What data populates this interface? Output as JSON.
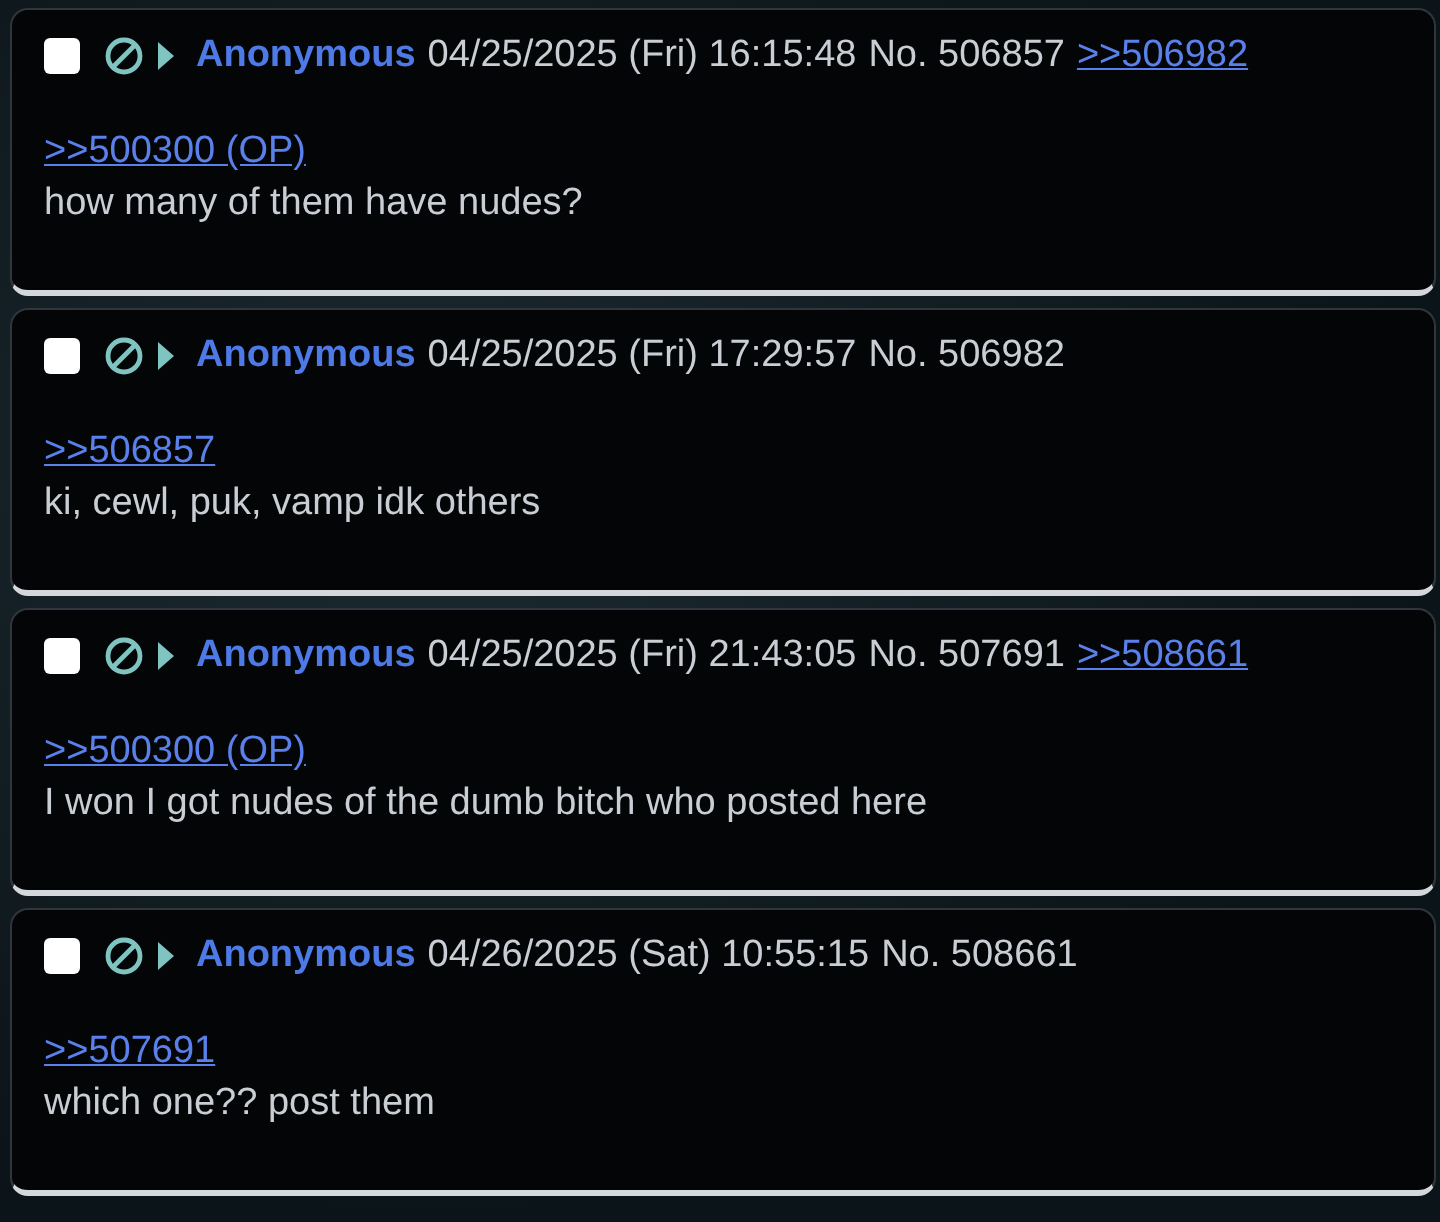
{
  "posts": [
    {
      "checked": false,
      "name": "Anonymous",
      "datetime": "04/25/2025 (Fri) 16:15:48",
      "number": "No. 506857",
      "replies": [
        ">>506982"
      ],
      "quote": ">>500300 (OP)",
      "message": "how many of them have nudes?"
    },
    {
      "checked": false,
      "name": "Anonymous",
      "datetime": "04/25/2025 (Fri) 17:29:57",
      "number": "No. 506982",
      "quote": ">>506857",
      "message": "ki, cewl, puk, vamp idk others"
    },
    {
      "checked": false,
      "name": "Anonymous",
      "datetime": "04/25/2025 (Fri) 21:43:05",
      "number": "No. 507691",
      "replies": [
        ">>508661"
      ],
      "quote": ">>500300 (OP)",
      "message": "I won I got nudes of the dumb bitch who posted here"
    },
    {
      "checked": false,
      "name": "Anonymous",
      "datetime": "04/26/2025 (Sat) 10:55:15",
      "number": "No. 508661",
      "quote": ">>507691",
      "message": "which one?? post them"
    }
  ]
}
